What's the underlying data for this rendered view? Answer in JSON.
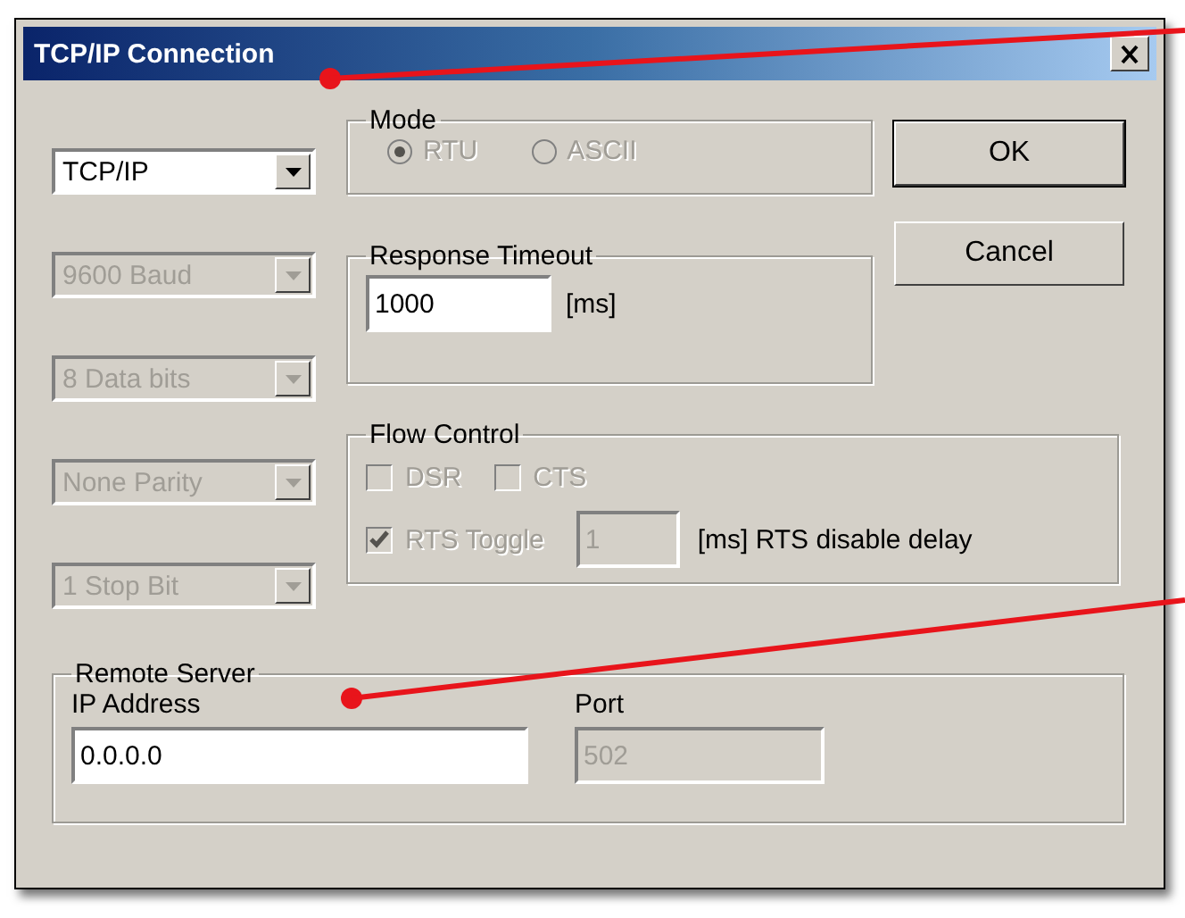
{
  "window": {
    "title": "TCP/IP Connection"
  },
  "settings": [
    {
      "value": "TCP/IP",
      "disabled": false
    },
    {
      "value": "9600 Baud",
      "disabled": true
    },
    {
      "value": "8 Data bits",
      "disabled": true
    },
    {
      "value": "None Parity",
      "disabled": true
    },
    {
      "value": "1 Stop Bit",
      "disabled": true
    }
  ],
  "mode": {
    "label": "Mode",
    "disabled": true,
    "options": [
      {
        "label": "RTU",
        "selected": true
      },
      {
        "label": "ASCII",
        "selected": false
      }
    ]
  },
  "response_timeout": {
    "label": "Response Timeout",
    "value": "1000",
    "unit": "[ms]"
  },
  "buttons": [
    {
      "label": "OK",
      "default": true
    },
    {
      "label": "Cancel",
      "default": false
    }
  ],
  "flow_control": {
    "label": "Flow Control",
    "disabled": true,
    "checkboxes": [
      {
        "label": "DSR",
        "checked": false
      },
      {
        "label": "CTS",
        "checked": false
      }
    ],
    "rts_toggle": {
      "label": "RTS Toggle",
      "checked": true
    },
    "delay_value": "1",
    "delay_unit": "[ms] RTS disable delay"
  },
  "remote_server": {
    "label": "Remote Server",
    "ip_label": "IP Address",
    "ip_value": "0.0.0.0",
    "port_label": "Port",
    "port_value": "502",
    "port_disabled": true
  }
}
